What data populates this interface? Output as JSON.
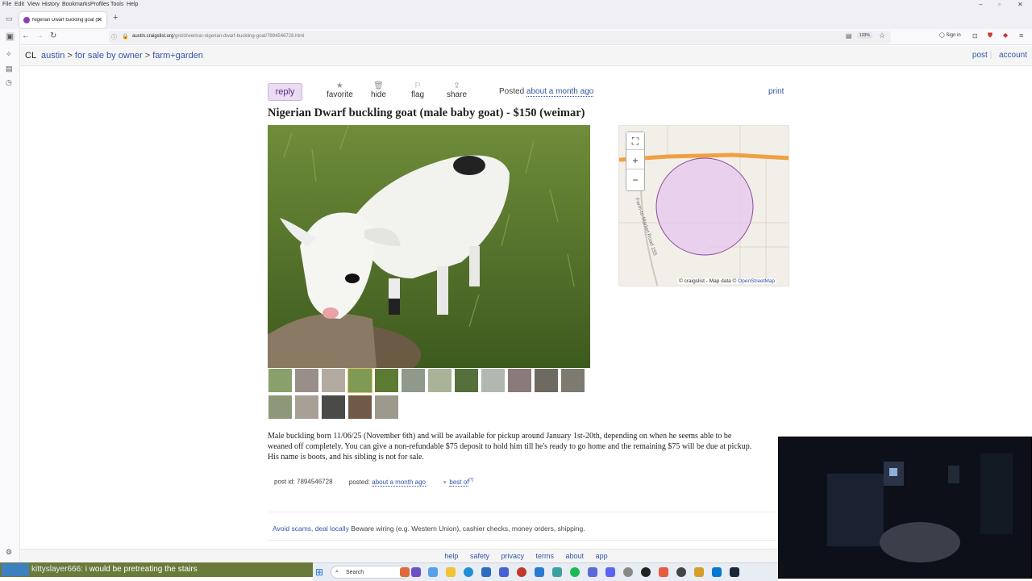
{
  "browser": {
    "menu": [
      "File",
      "Edit",
      "View",
      "History",
      "Bookmarks",
      "Profiles",
      "Tools",
      "Help"
    ],
    "tab_title": "Nigerian Dwarf buckling goat (m",
    "url_domain": "austin.craigslist.org",
    "url_path": "/grd/d/weimar-nigerian-dwarf-buckling-goat/7894546728.html",
    "zoom": "133%",
    "sign_in": "Sign in"
  },
  "header": {
    "logo": "CL",
    "breadcrumbs": [
      "austin",
      "for sale by owner",
      "farm+garden"
    ],
    "separator": ">",
    "post": "post",
    "account": "account"
  },
  "posting": {
    "reply": "reply",
    "actions": {
      "favorite": "favorite",
      "hide": "hide",
      "flag": "flag",
      "share": "share"
    },
    "posted_label": "Posted",
    "posted_value": "about a month ago",
    "print": "print",
    "title": "Nigerian Dwarf buckling goat (male baby goat) - $150 (weimar)",
    "description": [
      "Male buckling born 11/06/25 (November 6th) and will be available for pickup around January 1st-20th, depending on when he seems able to be",
      "weaned off completely. You can give a non-refundable $75 deposit to hold him till he's ready to go home and the remaining $75 will be due at pickup.",
      "His name is boots, and his sibling is not for sale."
    ],
    "post_id_label": "post id:",
    "post_id": "7894546728",
    "posted_meta_label": "posted:",
    "posted_meta_value": "about a month ago",
    "best_of": "best of",
    "best_of_sup": "[?]",
    "thumbnail_count": 17
  },
  "map": {
    "road_label": "Farm-to-Market Road 155",
    "attribution": "© craigslist - Map data ©",
    "attribution_link": "OpenStreetMap",
    "zoom_in": "+",
    "zoom_out": "−",
    "fullscreen": "⛶"
  },
  "scam": {
    "link": "Avoid scams, deal locally",
    "text": "Beware wiring (e.g. Western Union), cashier checks, money orders, shipping."
  },
  "footer": [
    "help",
    "safety",
    "privacy",
    "terms",
    "about",
    "app"
  ],
  "chat": {
    "user": "kittyslayer666",
    "message": ": i would be pretreating the stairs"
  },
  "taskbar": {
    "search_placeholder": "Search"
  },
  "colors": {
    "link": "#3355aa",
    "reply_bg": "#eadcf1",
    "map_circle": "#e6c8ec",
    "road": "#f0a040"
  }
}
